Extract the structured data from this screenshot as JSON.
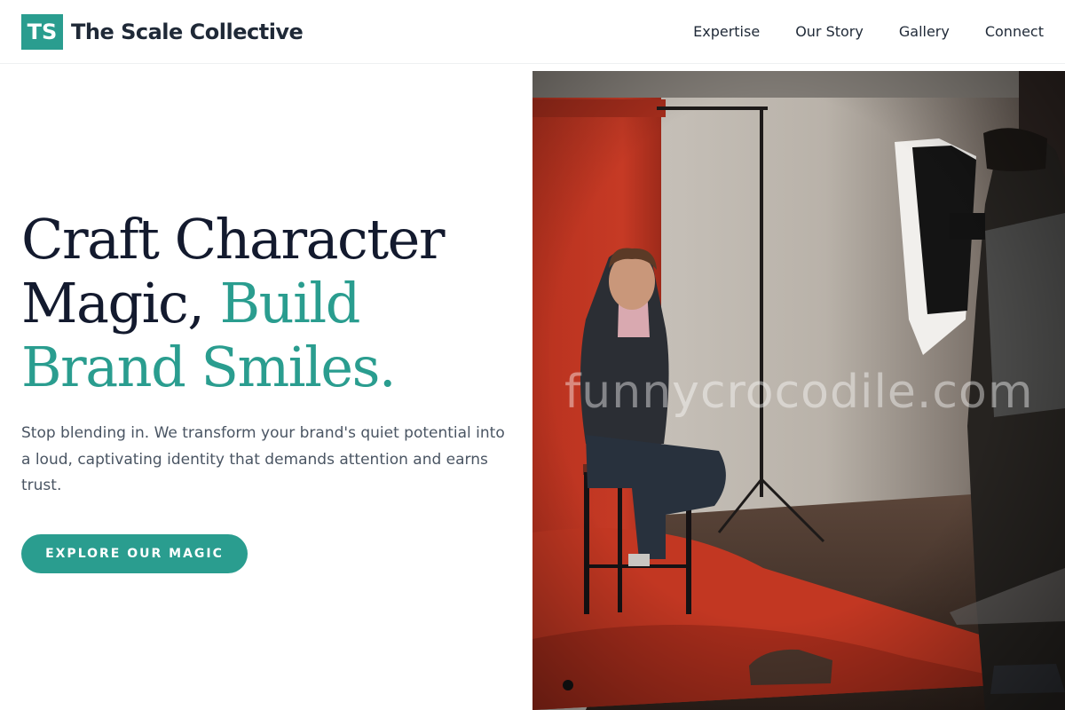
{
  "header": {
    "logo_mark": "TS",
    "brand_name": "The Scale Collective",
    "nav": [
      {
        "label": "Expertise"
      },
      {
        "label": "Our Story"
      },
      {
        "label": "Gallery"
      },
      {
        "label": "Connect"
      }
    ]
  },
  "hero": {
    "headline_line1": "Craft Character",
    "headline_line2a": "Magic, ",
    "headline_line2b": "Build",
    "headline_line3": "Brand Smiles.",
    "subtext": "Stop blending in. We transform your brand's quiet potential into a loud, captivating identity that demands attention and earns trust.",
    "cta_label": "EXPLORE OUR MAGIC"
  },
  "photo": {
    "watermark": "funnycrocodile.com"
  },
  "colors": {
    "accent": "#2a9d8f",
    "heading": "#131a2e",
    "body_text": "#4a5563"
  }
}
